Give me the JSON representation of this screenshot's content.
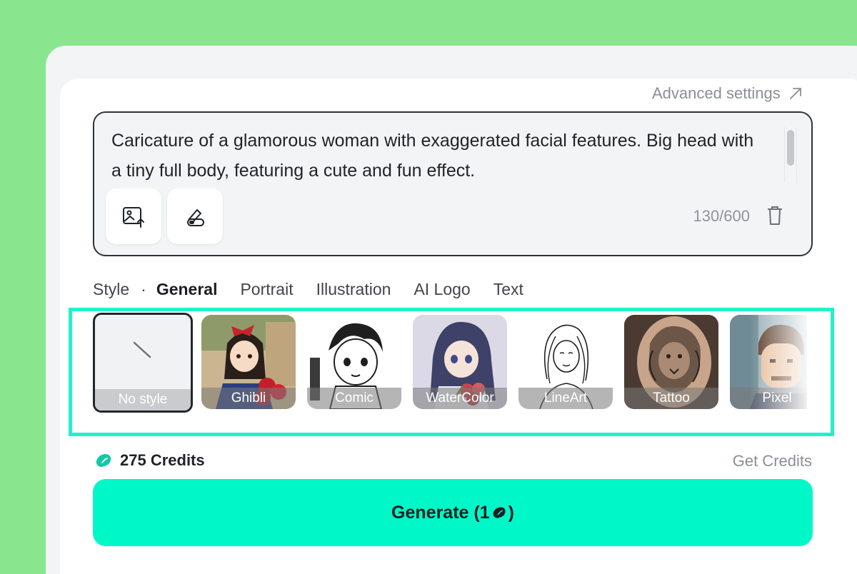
{
  "advanced_settings": {
    "label": "Advanced settings"
  },
  "prompt": {
    "text": "Caricature of a glamorous woman with exaggerated facial features. Big head with a tiny full body, featuring a cute and fun effect.",
    "counter": "130/600"
  },
  "tools": [
    {
      "icon": "image-upload-icon"
    },
    {
      "icon": "eraser-pencil-icon"
    }
  ],
  "tabs": {
    "prefix": "Style",
    "separator": "·",
    "items": [
      {
        "label": "General",
        "active": true
      },
      {
        "label": "Portrait",
        "active": false
      },
      {
        "label": "Illustration",
        "active": false
      },
      {
        "label": "AI Logo",
        "active": false
      },
      {
        "label": "Text",
        "active": false
      }
    ]
  },
  "styles": [
    {
      "label": "No style",
      "selected": true
    },
    {
      "label": "Ghibli",
      "selected": false
    },
    {
      "label": "Comic",
      "selected": false
    },
    {
      "label": "WaterColor",
      "selected": false
    },
    {
      "label": "LineArt",
      "selected": false
    },
    {
      "label": "Tattoo",
      "selected": false
    },
    {
      "label": "Pixel",
      "selected": false
    }
  ],
  "credits": {
    "amount": "275 Credits",
    "get_label": "Get Credits"
  },
  "generate": {
    "label": "Generate (1",
    "suffix": ")"
  },
  "colors": {
    "accent": "#00f8c9",
    "highlight": "#22f2c8",
    "background": "#89e58e"
  }
}
